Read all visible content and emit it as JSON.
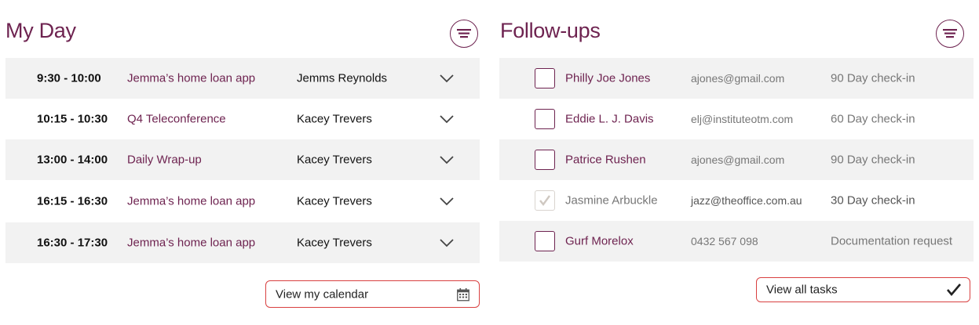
{
  "my_day": {
    "title": "My Day",
    "rows": [
      {
        "time": "9:30 - 10:00",
        "appointment": "Jemma’s home loan app",
        "person": "Jemms Reynolds"
      },
      {
        "time": "10:15 - 10:30",
        "appointment": "Q4 Teleconference",
        "person": "Kacey Trevers"
      },
      {
        "time": "13:00 - 14:00",
        "appointment": "Daily Wrap-up",
        "person": "Kacey Trevers"
      },
      {
        "time": "16:15 - 16:30",
        "appointment": "Jemma’s home loan app",
        "person": "Kacey Trevers"
      },
      {
        "time": "16:30 - 17:30",
        "appointment": "Jemma’s home loan app",
        "person": "Kacey Trevers"
      }
    ],
    "button_label": "View my calendar"
  },
  "follow_ups": {
    "title": "Follow-ups",
    "rows": [
      {
        "name": "Philly Joe Jones",
        "contact": "ajones@gmail.com",
        "task": "90 Day check-in",
        "done": false
      },
      {
        "name": "Eddie L. J. Davis",
        "contact": "elj@instituteotm.com",
        "task": "60 Day check-in",
        "done": false
      },
      {
        "name": "Patrice Rushen",
        "contact": "ajones@gmail.com",
        "task": "90 Day check-in",
        "done": false
      },
      {
        "name": "Jasmine Arbuckle",
        "contact": "jazz@theoffice.com.au",
        "task": "30 Day check-in",
        "done": true
      },
      {
        "name": "Gurf Morelox",
        "contact": "0432 567 098",
        "task": "Documentation request",
        "done": false
      }
    ],
    "button_label": "View all tasks"
  },
  "icons": {
    "filter": "filter-icon",
    "chevron": "chevron-down-icon",
    "calendar": "calendar-icon",
    "checkmark": "checkmark-icon"
  },
  "colors": {
    "accent": "#6e2350",
    "button_border": "#d94040",
    "row_shade": "#f2f2f2"
  }
}
